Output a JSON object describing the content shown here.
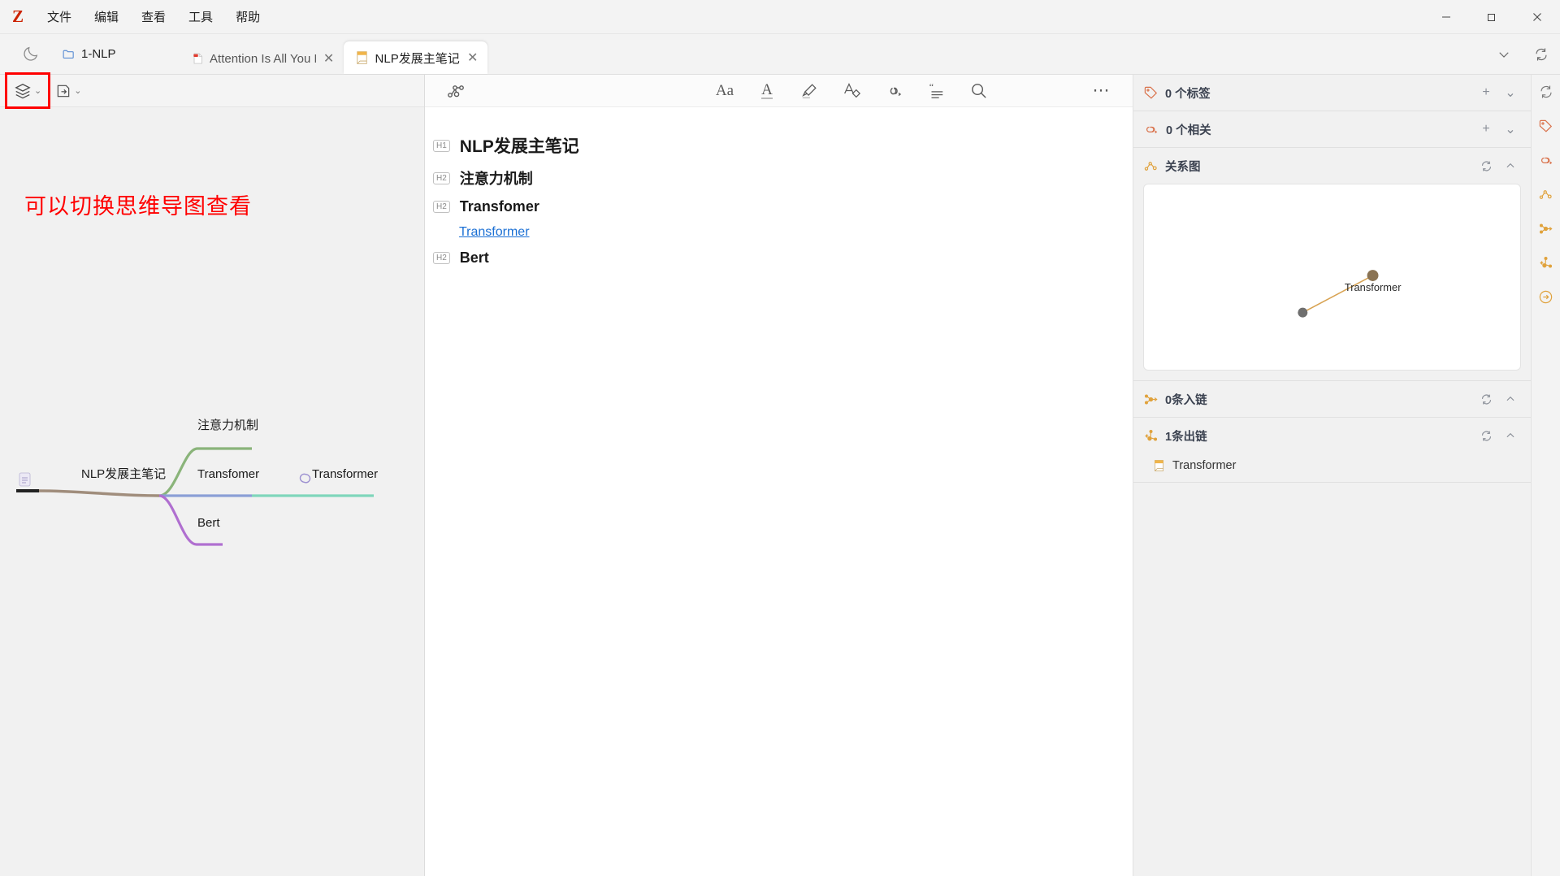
{
  "app": {
    "logo_text": "Z",
    "menus": [
      "文件",
      "编辑",
      "查看",
      "工具",
      "帮助"
    ],
    "window_controls": {
      "minimize": "—",
      "maximize": "❐",
      "close": "✕"
    }
  },
  "tabbar": {
    "theme_toggle_icon": "moon-icon",
    "breadcrumb_folder": "1-NLP",
    "tabs": [
      {
        "label": "Attention Is All You Need",
        "icon": "pdf-file-icon",
        "active": false,
        "close": "✕"
      },
      {
        "label": "NLP发展主笔记",
        "icon": "note-file-icon",
        "active": true,
        "close": "✕"
      }
    ],
    "chevron_down": "⌄",
    "sync_icon": "sync-icon"
  },
  "left_pane": {
    "toolbar": {
      "layers_button_icon": "layers-icon",
      "layers_chevron": "⌄",
      "export_button_icon": "save-export-icon",
      "export_chevron": "⌄"
    },
    "annotation": "可以切换思维导图查看",
    "mindmap": {
      "root": "NLP发展主笔记",
      "branches": [
        {
          "label": "注意力机制",
          "color": "#8ab47a"
        },
        {
          "label": "Transfomer",
          "color": "#8b9fd6"
        },
        {
          "label": "Bert",
          "color": "#b06fd0"
        }
      ],
      "leaf": {
        "label": "Transformer",
        "icon": "link-icon",
        "color": "#7fd6bb"
      }
    }
  },
  "editor": {
    "toolbar": {
      "graph_icon": "mindmap-node-icon",
      "font_size_icon": "Aa",
      "text_color_icon": "A",
      "highlight_icon": "highlighter-icon",
      "clear_format_icon": "clear-format-icon",
      "link_icon": "link-icon",
      "quote_icon": "blockquote-icon",
      "search_icon": "search-icon",
      "more_icon": "⋯"
    },
    "lines": [
      {
        "tag": "H1",
        "text": "NLP发展主笔记",
        "type": "h1"
      },
      {
        "tag": "H2",
        "text": "注意力机制",
        "type": "h2"
      },
      {
        "tag": "H2",
        "text": "Transfomer",
        "type": "h2"
      },
      {
        "tag": "",
        "text": "Transformer",
        "type": "link"
      },
      {
        "tag": "H2",
        "text": "Bert",
        "type": "h2"
      }
    ]
  },
  "right_pane": {
    "sections": [
      {
        "id": "tags",
        "title": "0 个标签",
        "icon": "tag-icon",
        "actions": [
          "+",
          "⌄"
        ]
      },
      {
        "id": "related",
        "title": "0 个相关",
        "icon": "related-links-icon",
        "actions": [
          "+",
          "⌄"
        ]
      },
      {
        "id": "graph",
        "title": "关系图",
        "icon": "graph-icon",
        "actions": [
          "refresh-icon",
          "⌃"
        ]
      },
      {
        "id": "backlinks",
        "title": "0条入链",
        "icon": "backlink-icon",
        "actions": [
          "refresh-icon",
          "⌃"
        ]
      },
      {
        "id": "outlinks",
        "title": "1条出链",
        "icon": "outlink-icon",
        "actions": [
          "refresh-icon",
          "⌃"
        ]
      }
    ],
    "graph_node_label": "Transformer",
    "outlink_items": [
      {
        "label": "Transformer",
        "icon": "note-file-icon"
      }
    ]
  },
  "rail": {
    "icons": [
      "sync-icon",
      "tag-icon",
      "related-links-icon",
      "graph-icon",
      "backlink-icon",
      "outlink-icon",
      "collapse-icon"
    ]
  },
  "colors": {
    "accent_red": "#cc2200",
    "annotation_red": "#ff0000",
    "link_blue": "#1a6fd4",
    "panel_orange": "#d97a2b",
    "graph_node": "#808080",
    "graph_edge": "#d8a353"
  }
}
